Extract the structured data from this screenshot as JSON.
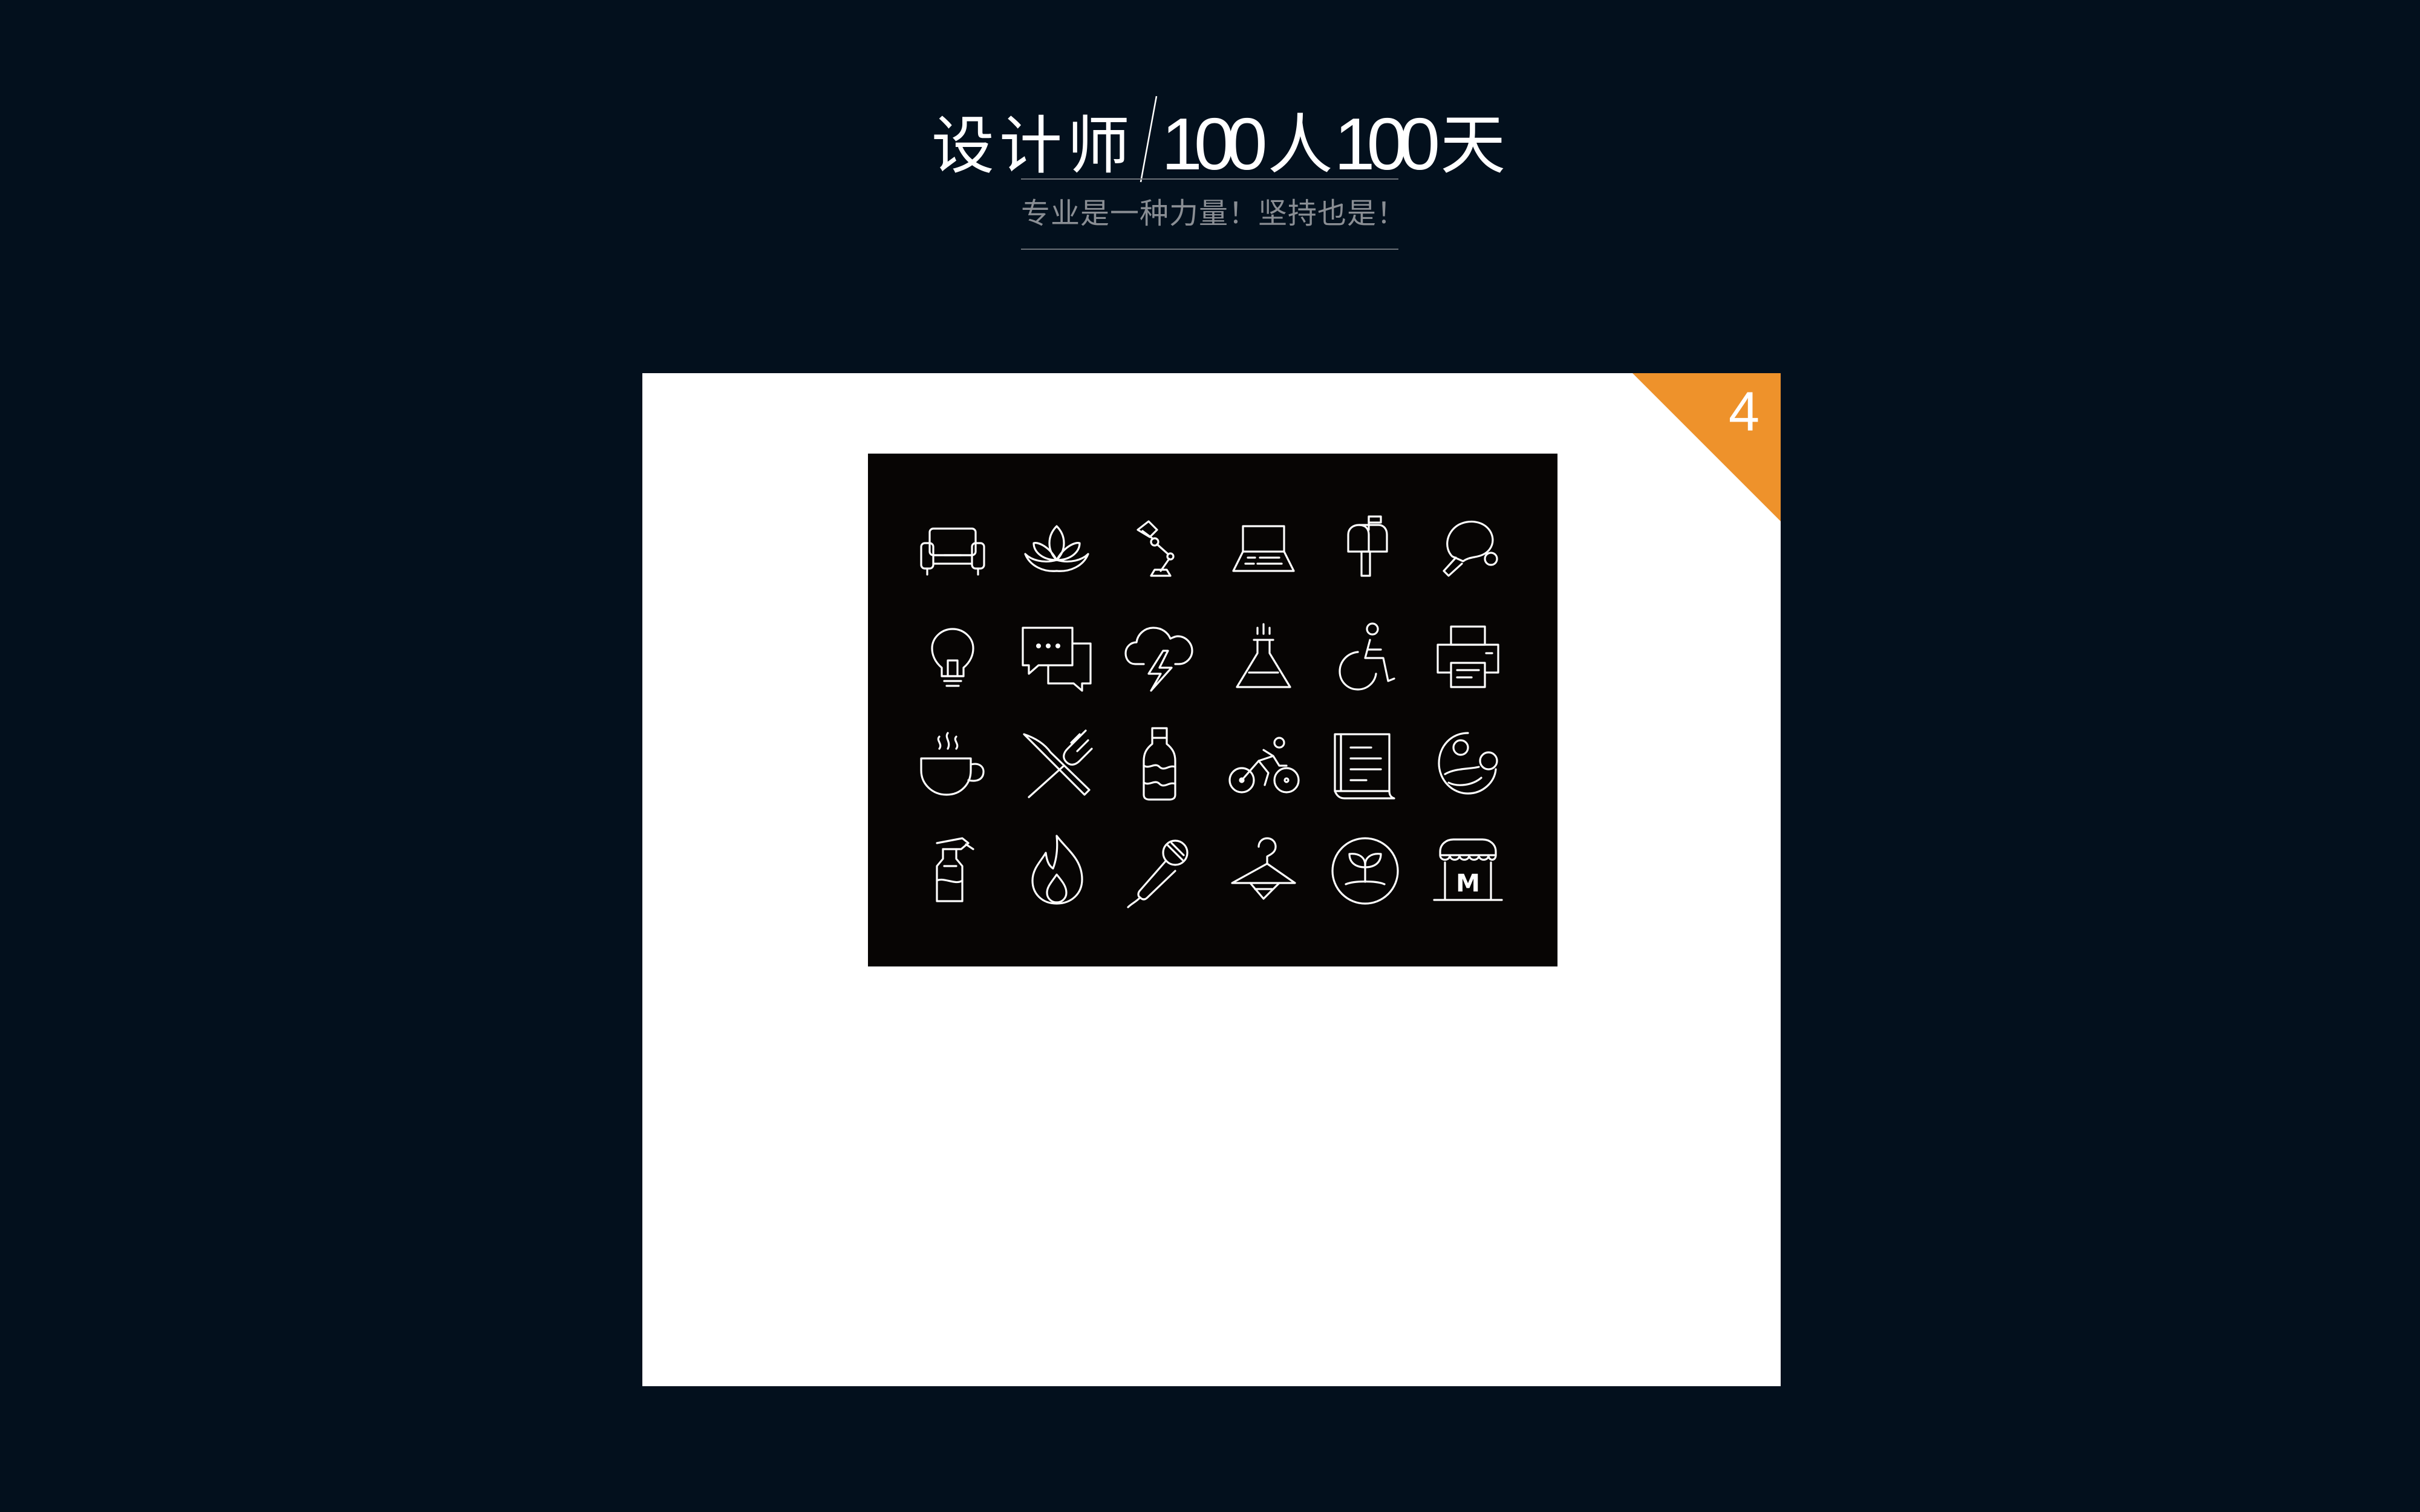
{
  "header": {
    "title_cn": "设计师",
    "title_num_1": "100",
    "title_person": "人",
    "title_num_2": "100",
    "title_day": "天",
    "subtitle": "专业是一种力量！坚持也是！"
  },
  "card": {
    "badge_number": "4"
  },
  "colors": {
    "background": "#03101d",
    "card": "#ffffff",
    "icon_sheet": "#070504",
    "badge": "#ee922b",
    "icon_stroke": "#ffffff"
  },
  "icons": [
    [
      "sofa-icon",
      "lotus-icon",
      "desk-lamp-icon",
      "laptop-icon",
      "mailbox-icon",
      "ping-pong-icon"
    ],
    [
      "lightbulb-icon",
      "chat-bubbles-icon",
      "thunderstorm-icon",
      "lab-flask-icon",
      "wheelchair-icon",
      "printer-icon"
    ],
    [
      "coffee-cup-icon",
      "fork-knife-icon",
      "water-bottle-icon",
      "cyclist-icon",
      "document-icon",
      "mother-baby-icon"
    ],
    [
      "spray-bottle-icon",
      "fire-icon",
      "microphone-icon",
      "clothes-hanger-icon",
      "sprout-icon",
      "store-icon"
    ]
  ],
  "store_letter": "M"
}
